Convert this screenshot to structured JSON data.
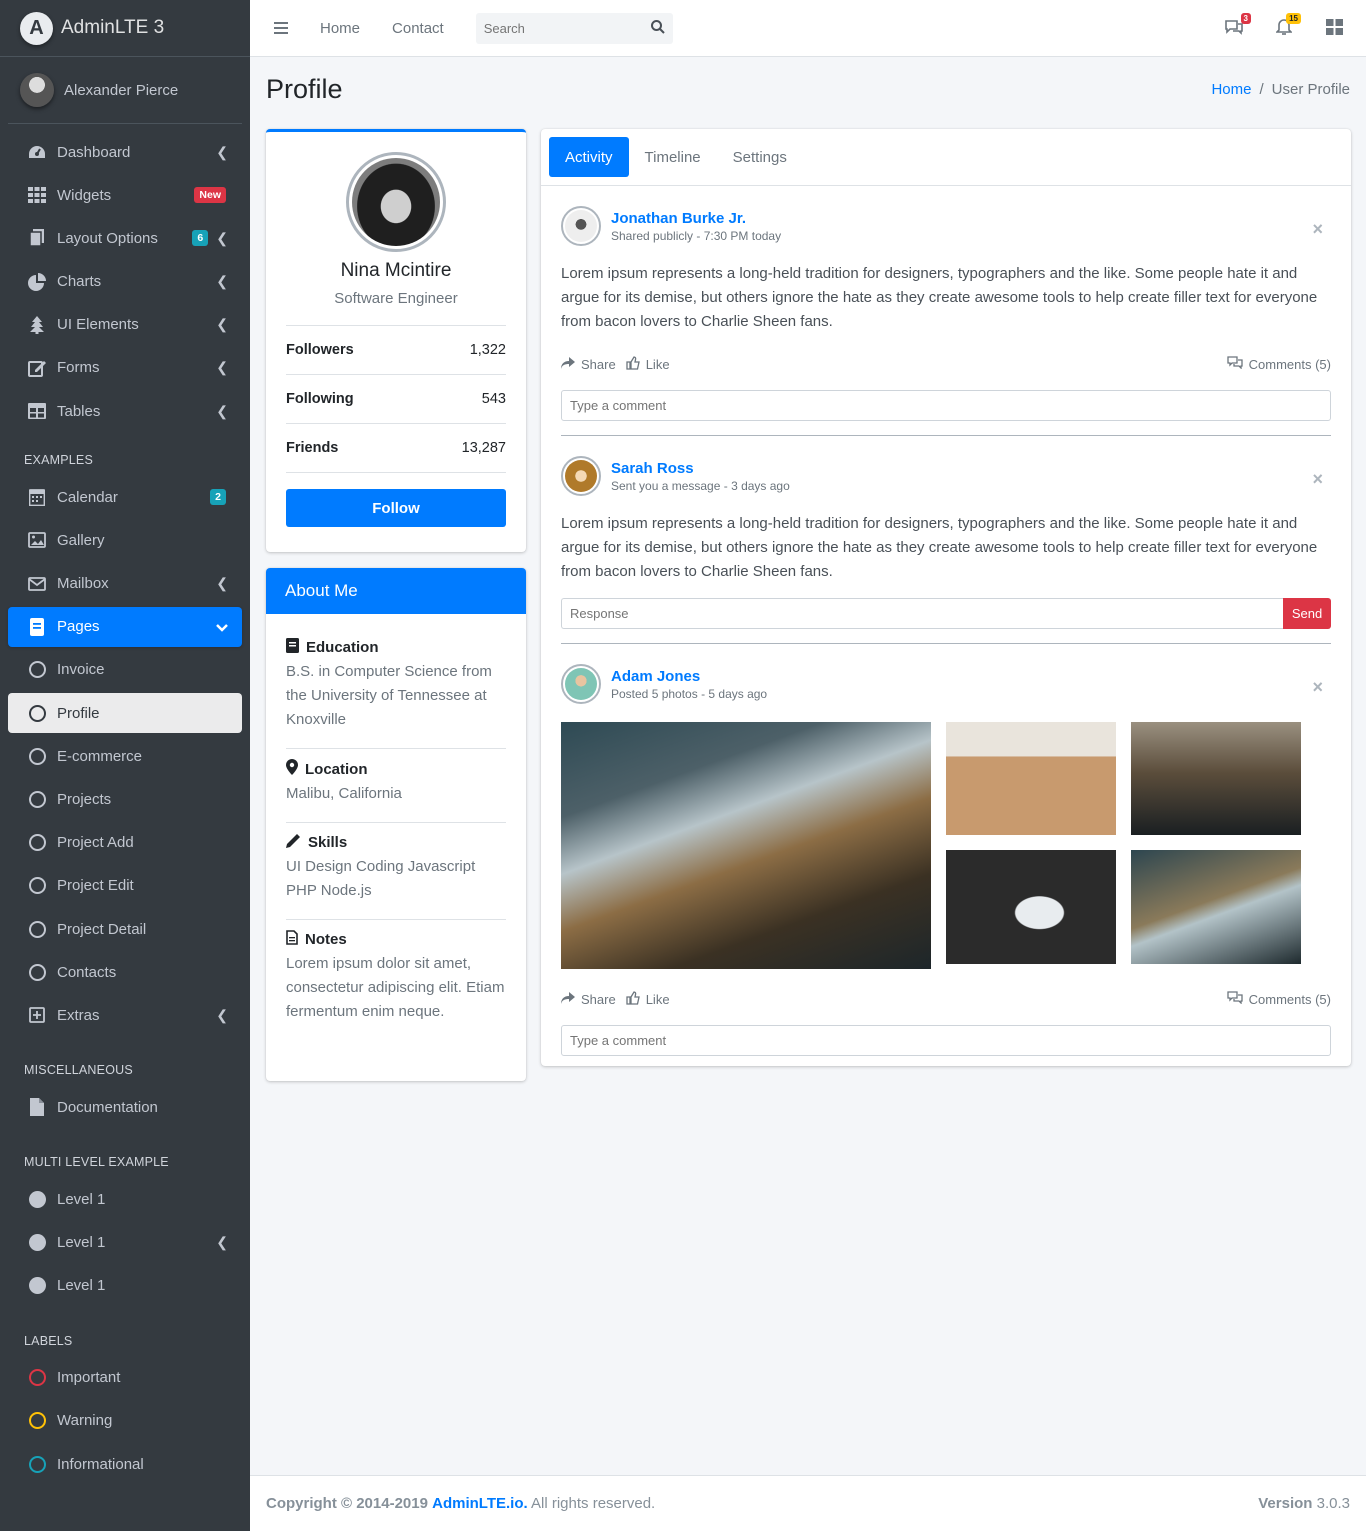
{
  "brand": {
    "logo_letter": "A",
    "name": "AdminLTE 3"
  },
  "user": {
    "name": "Alexander Pierce"
  },
  "sidebar": {
    "main_items": [
      {
        "label": "Dashboard",
        "icon": "dashboard-icon"
      },
      {
        "label": "Widgets",
        "icon": "widgets-icon",
        "badge": "New"
      },
      {
        "label": "Layout Options",
        "icon": "layout-icon",
        "badge": "6"
      },
      {
        "label": "Charts",
        "icon": "chart-pie-icon"
      },
      {
        "label": "UI Elements",
        "icon": "tree-icon"
      },
      {
        "label": "Forms",
        "icon": "edit-icon"
      },
      {
        "label": "Tables",
        "icon": "table-icon"
      }
    ],
    "examples_header": "EXAMPLES",
    "examples": [
      {
        "label": "Calendar",
        "icon": "calendar-icon",
        "badge": "2"
      },
      {
        "label": "Gallery",
        "icon": "image-icon"
      },
      {
        "label": "Mailbox",
        "icon": "envelope-icon"
      },
      {
        "label": "Pages",
        "icon": "book-icon"
      },
      {
        "label": "Invoice"
      },
      {
        "label": "Profile"
      },
      {
        "label": "E-commerce"
      },
      {
        "label": "Projects"
      },
      {
        "label": "Project Add"
      },
      {
        "label": "Project Edit"
      },
      {
        "label": "Project Detail"
      },
      {
        "label": "Contacts"
      },
      {
        "label": "Extras",
        "icon": "plus-square-icon"
      }
    ],
    "misc_header": "MISCELLANEOUS",
    "misc": [
      {
        "label": "Documentation",
        "icon": "file-icon"
      }
    ],
    "multi_header": "MULTI LEVEL EXAMPLE",
    "multi": [
      {
        "label": "Level 1"
      },
      {
        "label": "Level 1"
      },
      {
        "label": "Level 1"
      }
    ],
    "labels_header": "LABELS",
    "labels": [
      {
        "label": "Important",
        "color": "#dc3545"
      },
      {
        "label": "Warning",
        "color": "#ffc107"
      },
      {
        "label": "Informational",
        "color": "#17a2b8"
      }
    ]
  },
  "topnav": {
    "home": "Home",
    "contact": "Contact",
    "search_placeholder": "Search",
    "messages_count": "3",
    "notifications_count": "15"
  },
  "header": {
    "title": "Profile",
    "breadcrumb_home": "Home",
    "breadcrumb_current": "User Profile"
  },
  "profile": {
    "name": "Nina Mcintire",
    "job": "Software Engineer",
    "followers_label": "Followers",
    "followers": "1,322",
    "following_label": "Following",
    "following": "543",
    "friends_label": "Friends",
    "friends": "13,287",
    "follow_button": "Follow"
  },
  "about": {
    "title": "About Me",
    "education_title": "Education",
    "education_text": "B.S. in Computer Science from the University of Tennessee at Knoxville",
    "location_title": "Location",
    "location_text": "Malibu, California",
    "skills_title": "Skills",
    "skills_text": "UI Design Coding Javascript PHP Node.js",
    "notes_title": "Notes",
    "notes_text": "Lorem ipsum dolor sit amet, consectetur adipiscing elit. Etiam fermentum enim neque."
  },
  "tabs": [
    "Activity",
    "Timeline",
    "Settings"
  ],
  "posts": [
    {
      "user": "Jonathan Burke Jr.",
      "desc": "Shared publicly - 7:30 PM today",
      "text": "Lorem ipsum represents a long-held tradition for designers, typographers and the like. Some people hate it and argue for its demise, but others ignore the hate as they create awesome tools to help create filler text for everyone from bacon lovers to Charlie Sheen fans.",
      "share": "Share",
      "like": "Like",
      "comments": "Comments (5)",
      "input_placeholder": "Type a comment"
    },
    {
      "user": "Sarah Ross",
      "desc": "Sent you a message - 3 days ago",
      "text": "Lorem ipsum represents a long-held tradition for designers, typographers and the like. Some people hate it and argue for its demise, but others ignore the hate as they create awesome tools to help create filler text for everyone from bacon lovers to Charlie Sheen fans.",
      "input_placeholder": "Response",
      "send": "Send"
    },
    {
      "user": "Adam Jones",
      "desc": "Posted 5 photos - 5 days ago",
      "share": "Share",
      "like": "Like",
      "comments": "Comments (5)",
      "input_placeholder": "Type a comment"
    }
  ],
  "footer": {
    "copyright": "Copyright © 2014-2019",
    "link": "AdminLTE.io.",
    "rights": "All rights reserved.",
    "version_label": "Version",
    "version": "3.0.3"
  }
}
